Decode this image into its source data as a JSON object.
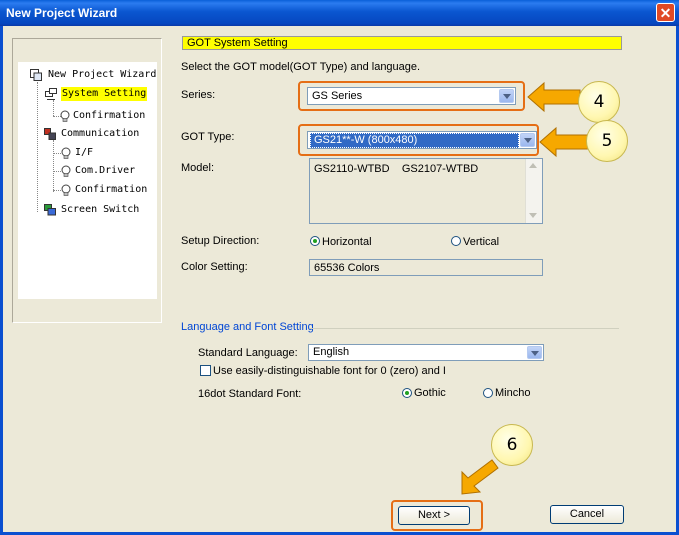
{
  "window": {
    "title": "New Project Wizard",
    "close_glyph": "✕"
  },
  "tree": {
    "items": [
      {
        "label": "New Project Wizard"
      },
      {
        "label": "System Setting"
      },
      {
        "label": "Confirmation"
      },
      {
        "label": "Communication"
      },
      {
        "label": "I/F"
      },
      {
        "label": "Com.Driver"
      },
      {
        "label": "Confirmation"
      },
      {
        "label": "Screen Switch"
      }
    ]
  },
  "main": {
    "section_title": "GOT System Setting",
    "instruction": "Select the GOT model(GOT Type) and language.",
    "series": {
      "label": "Series:",
      "value": "GS Series"
    },
    "got_type": {
      "label": "GOT Type:",
      "value": "GS21**-W (800x480)"
    },
    "model": {
      "label": "Model:",
      "value": "GS2110-WTBD    GS2107-WTBD"
    },
    "setup_direction": {
      "label": "Setup Direction:",
      "options": [
        "Horizontal",
        "Vertical"
      ],
      "selected": "Horizontal"
    },
    "color_setting": {
      "label": "Color Setting:",
      "value": "65536 Colors"
    }
  },
  "language": {
    "group_title": "Language and Font Setting",
    "standard_language": {
      "label": "Standard Language:",
      "value": "English"
    },
    "distinguishable_font": {
      "label": "Use easily-distinguishable font for 0 (zero) and I",
      "checked": false
    },
    "font_16dot": {
      "label": "16dot Standard Font:",
      "options": [
        "Gothic",
        "Mincho"
      ],
      "selected": "Gothic"
    }
  },
  "buttons": {
    "next": "Next >",
    "cancel": "Cancel"
  },
  "callouts": {
    "series": "4",
    "got_type": "5",
    "next": "6"
  },
  "colors": {
    "accent_orange": "#e56e15",
    "highlight_yellow": "#ffff00",
    "callout_arrow": "#f6a800"
  }
}
